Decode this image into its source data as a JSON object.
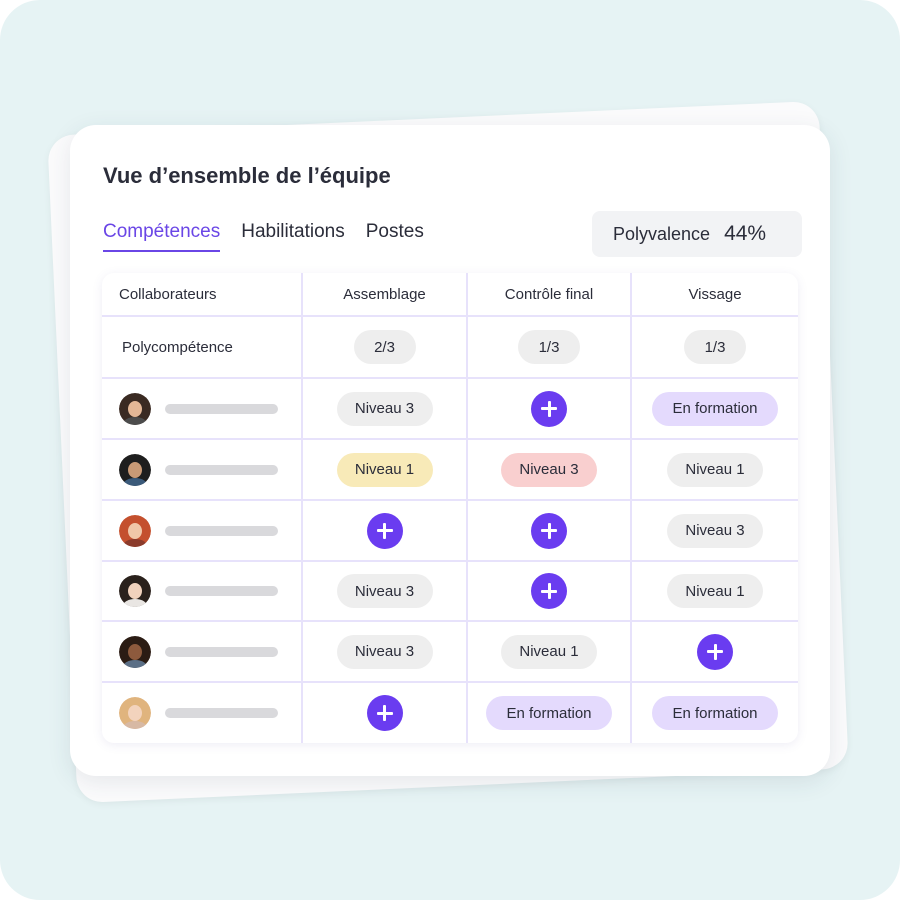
{
  "title": "Vue d’ensemble de l’équipe",
  "tabs": [
    {
      "label": "Compétences",
      "active": true
    },
    {
      "label": "Habilitations",
      "active": false
    },
    {
      "label": "Postes",
      "active": false
    }
  ],
  "polyvalence": {
    "label": "Polyvalence",
    "value": "44%"
  },
  "table": {
    "headers": [
      "Collaborateurs",
      "Assemblage",
      "Contrôle final",
      "Vissage"
    ],
    "summary_row": {
      "label": "Polycompétence",
      "values": [
        "2/3",
        "1/3",
        "1/3"
      ]
    },
    "rows": [
      {
        "avatar": {
          "hair": "#3a2a22",
          "skin": "#e3b796",
          "shirt": "#4c4c4c"
        },
        "cells": [
          {
            "type": "level",
            "text": "Niveau 3"
          },
          {
            "type": "add"
          },
          {
            "type": "training",
            "text": "En formation"
          }
        ]
      },
      {
        "avatar": {
          "hair": "#1e1e1e",
          "skin": "#c99a76",
          "shirt": "#3b5a7a"
        },
        "cells": [
          {
            "type": "level-yellow",
            "text": "Niveau 1"
          },
          {
            "type": "level-red",
            "text": "Niveau 3"
          },
          {
            "type": "level",
            "text": "Niveau 1"
          }
        ]
      },
      {
        "avatar": {
          "hair": "#c4502e",
          "skin": "#f0c7a8",
          "shirt": "#8b3b2b"
        },
        "cells": [
          {
            "type": "add"
          },
          {
            "type": "add"
          },
          {
            "type": "level",
            "text": "Niveau 3"
          }
        ]
      },
      {
        "avatar": {
          "hair": "#2a211c",
          "skin": "#f1d2bd",
          "shirt": "#e9e6e3"
        },
        "cells": [
          {
            "type": "level",
            "text": "Niveau 3"
          },
          {
            "type": "add"
          },
          {
            "type": "level",
            "text": "Niveau 1"
          }
        ]
      },
      {
        "avatar": {
          "hair": "#2b1c14",
          "skin": "#8d5a3d",
          "shirt": "#5b6f86"
        },
        "cells": [
          {
            "type": "level",
            "text": "Niveau 3"
          },
          {
            "type": "level",
            "text": "Niveau 1"
          },
          {
            "type": "add"
          }
        ]
      },
      {
        "avatar": {
          "hair": "#e0b47e",
          "skin": "#f3d3bd",
          "shirt": "#d7b9a4"
        },
        "cells": [
          {
            "type": "add"
          },
          {
            "type": "training",
            "text": "En formation"
          },
          {
            "type": "training",
            "text": "En formation"
          }
        ]
      }
    ]
  },
  "colors": {
    "accent": "#6a46e6",
    "level": "#eeeeee",
    "level-yellow": "#f8eab8",
    "level-red": "#f9cfcf",
    "training": "#e4dafd",
    "summary": "#eeeeee"
  }
}
